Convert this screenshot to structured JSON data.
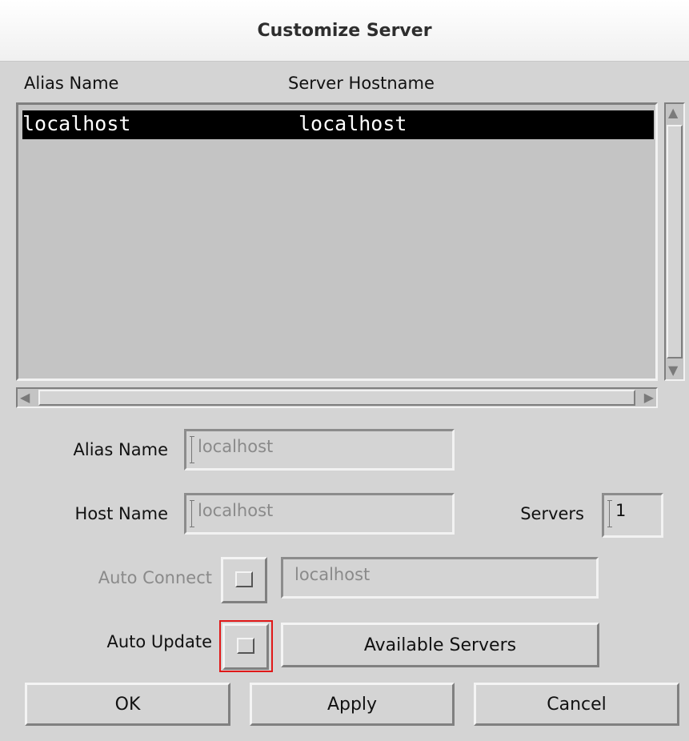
{
  "window": {
    "title": "Customize Server"
  },
  "list": {
    "headers": {
      "alias": "Alias Name",
      "hostname": "Server Hostname"
    },
    "rows": [
      {
        "alias": "localhost",
        "hostname": "localhost",
        "selected": true
      }
    ]
  },
  "form": {
    "alias_label": "Alias Name",
    "alias_value": "localhost",
    "host_label": "Host Name",
    "host_value": "localhost",
    "servers_label": "Servers",
    "servers_value": "1",
    "auto_connect_label": "Auto Connect",
    "auto_connect_value": "localhost",
    "auto_update_label": "Auto Update",
    "available_servers_label": "Available Servers"
  },
  "buttons": {
    "ok": "OK",
    "apply": "Apply",
    "cancel": "Cancel"
  },
  "icons": {
    "scroll_up": "scroll-up-arrow-icon",
    "scroll_down": "scroll-down-arrow-icon",
    "scroll_left": "scroll-left-arrow-icon",
    "scroll_right": "scroll-right-arrow-icon"
  },
  "colors": {
    "selection_bg": "#000000",
    "focus_ring": "#e01818",
    "background": "#d4d4d4"
  }
}
